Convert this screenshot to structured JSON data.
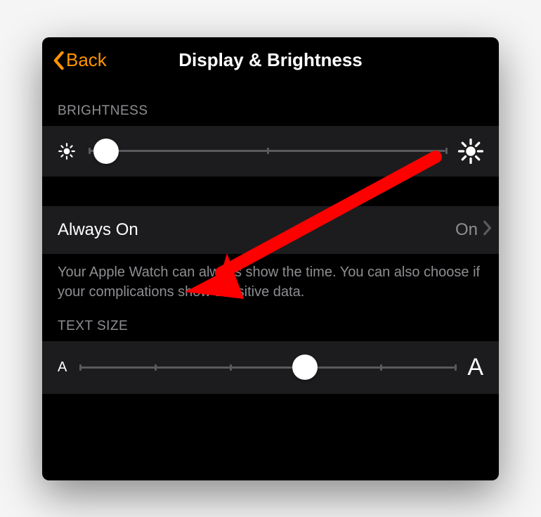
{
  "nav": {
    "back_label": "Back",
    "title": "Display & Brightness"
  },
  "brightness": {
    "header": "BRIGHTNESS",
    "value_pct": 5,
    "steps": 3
  },
  "always_on": {
    "label": "Always On",
    "value": "On",
    "footer": "Your Apple Watch can always show the time. You can also choose if your complications show sensitive data."
  },
  "text_size": {
    "header": "TEXT SIZE",
    "value_pct": 60,
    "small_glyph": "A",
    "large_glyph": "A",
    "steps": 6
  },
  "annotation": {
    "arrow_color": "#ff0000"
  }
}
